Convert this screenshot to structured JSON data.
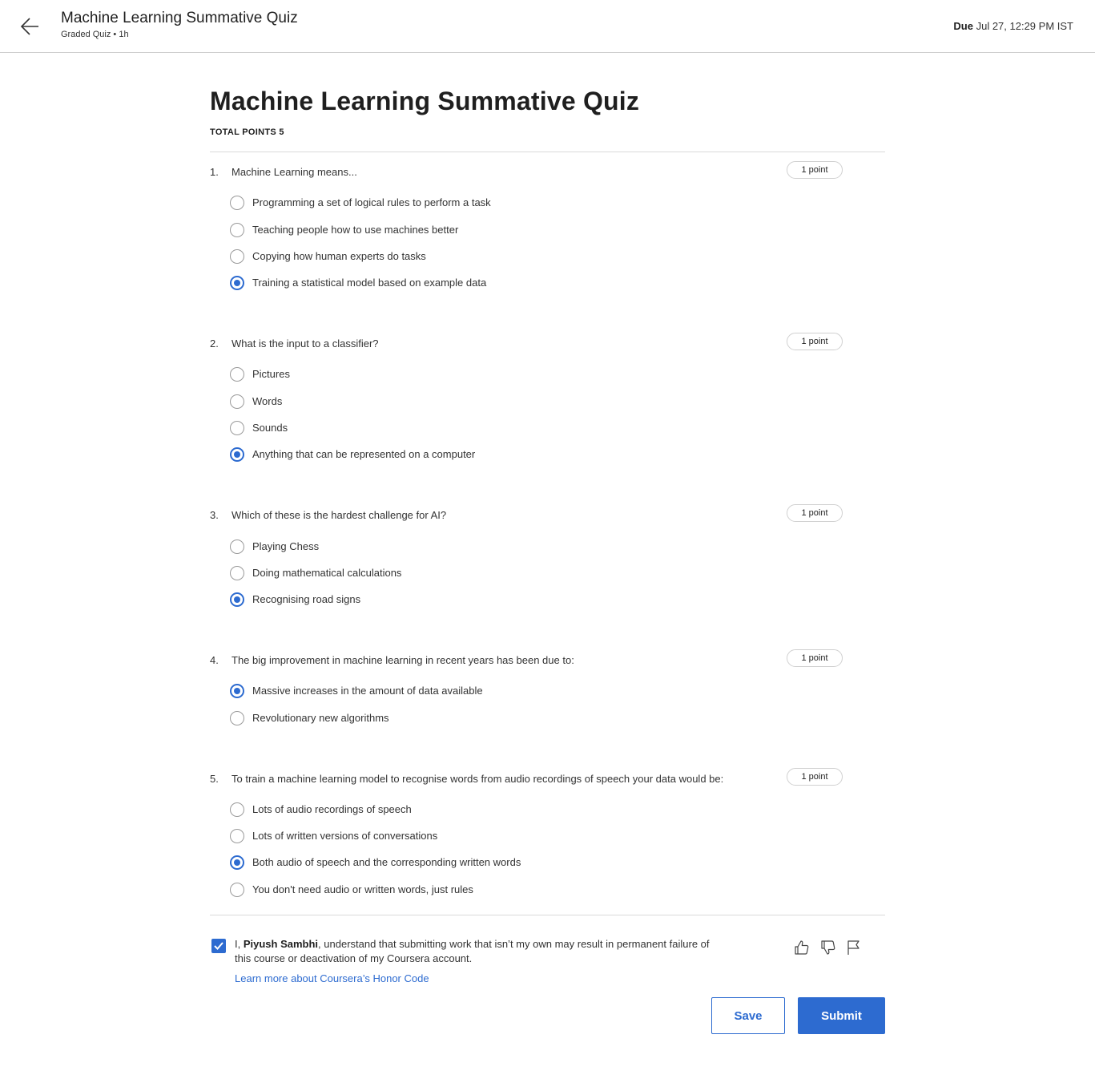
{
  "header": {
    "title": "Machine Learning Summative Quiz",
    "subtitle": "Graded Quiz • 1h",
    "due_label": "Due",
    "due_value": "Jul 27, 12:29 PM IST",
    "back_icon": "arrow-left-icon"
  },
  "main": {
    "title": "Machine Learning Summative Quiz",
    "total_points": "TOTAL POINTS 5"
  },
  "questions": [
    {
      "number": "1.",
      "text": "Machine Learning means...",
      "points": "1 point",
      "options": [
        {
          "label": "Programming a set of logical rules to perform a task",
          "selected": false
        },
        {
          "label": "Teaching people how to use machines better",
          "selected": false
        },
        {
          "label": "Copying how human experts do tasks",
          "selected": false
        },
        {
          "label": "Training a statistical model based on example data",
          "selected": true
        }
      ]
    },
    {
      "number": "2.",
      "text": "What is the input to a classifier?",
      "points": "1 point",
      "options": [
        {
          "label": "Pictures",
          "selected": false
        },
        {
          "label": "Words",
          "selected": false
        },
        {
          "label": "Sounds",
          "selected": false
        },
        {
          "label": "Anything that can be represented on a computer",
          "selected": true
        }
      ]
    },
    {
      "number": "3.",
      "text": "Which of these is the hardest challenge for AI?",
      "points": "1 point",
      "options": [
        {
          "label": "Playing Chess",
          "selected": false
        },
        {
          "label": "Doing mathematical calculations",
          "selected": false
        },
        {
          "label": "Recognising road signs",
          "selected": true
        }
      ]
    },
    {
      "number": "4.",
      "text": "The big improvement in machine learning in recent years has been due to:",
      "points": "1 point",
      "options": [
        {
          "label": "Massive increases in the amount of data available",
          "selected": true
        },
        {
          "label": "Revolutionary new algorithms",
          "selected": false
        }
      ]
    },
    {
      "number": "5.",
      "text": "To train a machine learning model to recognise words from audio recordings of speech your data would be:",
      "points": "1 point",
      "options": [
        {
          "label": "Lots of audio recordings of speech",
          "selected": false
        },
        {
          "label": "Lots of written versions of conversations",
          "selected": false
        },
        {
          "label": "Both audio of speech and the corresponding written words",
          "selected": true
        },
        {
          "label": "You don't need audio or written words, just rules",
          "selected": false
        }
      ]
    }
  ],
  "honor": {
    "checked": true,
    "prefix": "I, ",
    "name": "Piyush Sambhi",
    "statement": ", understand that submitting work that isn’t my own may result in permanent failure of this course or deactivation of my Coursera account.",
    "link": "Learn more about Coursera’s Honor Code"
  },
  "feedback_icons": [
    "thumbs-up-icon",
    "thumbs-down-icon",
    "flag-icon"
  ],
  "actions": {
    "save": "Save",
    "submit": "Submit"
  },
  "colors": {
    "accent": "#2d6bd0",
    "text": "#333333",
    "divider": "#dadada"
  }
}
